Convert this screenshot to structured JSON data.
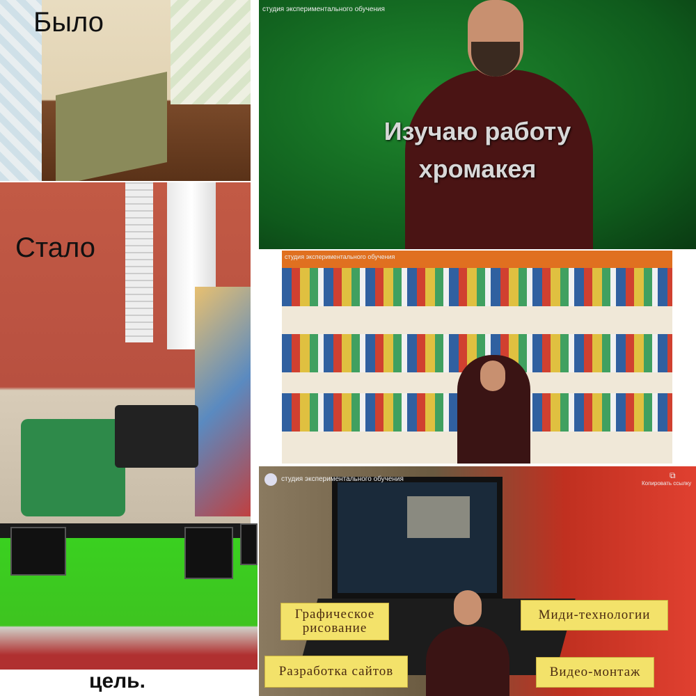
{
  "panels": {
    "before": {
      "caption": "Было"
    },
    "after": {
      "caption": "Стало"
    },
    "goal": {
      "caption": "цель."
    },
    "chroma": {
      "channel": "студия экспериментального обучения",
      "line1": "Изучаю работу",
      "line2": "хромакея"
    },
    "shop": {
      "channel": "студия экспериментального обучения"
    },
    "laptop": {
      "channel": "студия экспериментального обучения",
      "copy_link": "Копировать ссылку",
      "tags": [
        "Графическое рисование",
        "Миди-технологии",
        "Разработка сайтов",
        "Видео-монтаж"
      ]
    }
  }
}
